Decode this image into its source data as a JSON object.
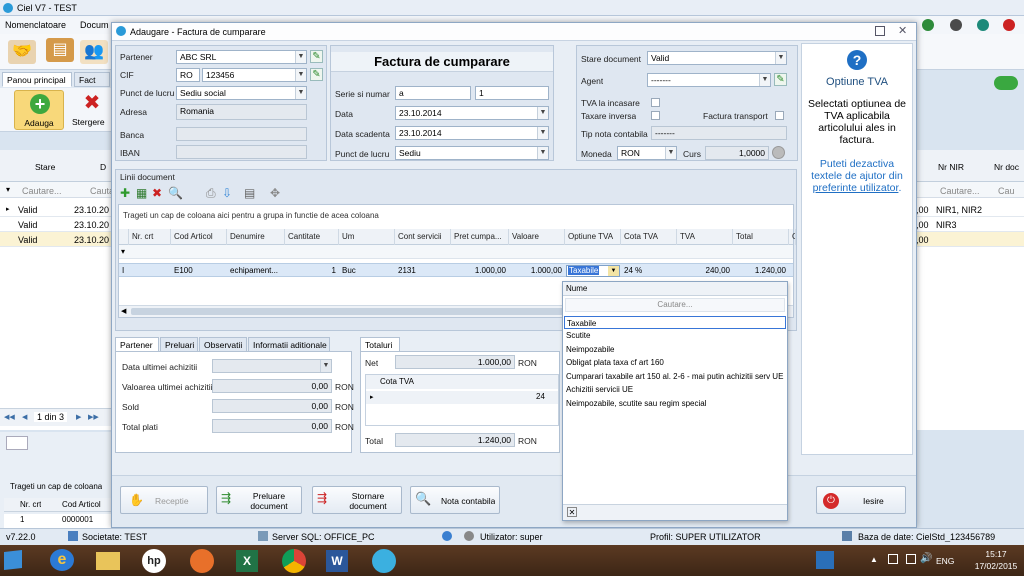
{
  "app": {
    "title": "Ciel V7 - TEST",
    "menu": [
      "Nomenclatoare",
      "Docum"
    ],
    "tabs": [
      "Panou principal",
      "Fact"
    ],
    "ribbon": {
      "add": "Adauga",
      "delete": "Stergere"
    },
    "left_grid": {
      "headers": [
        "Stare",
        "D"
      ],
      "filter_placeholder": "Cautare...",
      "filter_placeholder2": "Cauta",
      "rows": [
        [
          "Valid",
          "23.10.20"
        ],
        [
          "Valid",
          "23.10.20"
        ],
        [
          "Valid",
          "23.10.20"
        ]
      ],
      "pager": "1 din 3"
    },
    "right_grid": {
      "headers": [
        "Nr NIR",
        "Nr doc"
      ],
      "filter": "Cautare...",
      "filter2": "Cau",
      "rows": [
        [
          ",00",
          "NIR1, NIR2"
        ],
        [
          ",00",
          "NIR3"
        ],
        [
          ",00",
          ""
        ]
      ]
    },
    "bottom_panel": {
      "group_hint": "Trageti un cap de coloana",
      "headers": [
        "Nr. crt",
        "Cod Articol"
      ],
      "row": [
        "1",
        "0000001"
      ]
    },
    "status": {
      "version": "v7.22.0",
      "company": "Societate: TEST",
      "server": "Server SQL: OFFICE_PC",
      "user": "Utilizator: super",
      "profile": "Profil: SUPER UTILIZATOR",
      "database": "Baza de date: CielStd_123456789"
    },
    "taskbar": {
      "lang": "ENG",
      "time": "15:17",
      "date": "17/02/2015"
    }
  },
  "dialog": {
    "title": "Adaugare - Factura de cumparare",
    "partner": {
      "partner_label": "Partener",
      "partner_value": "ABC SRL",
      "cif_label": "CIF",
      "cif_prefix": "RO",
      "cif_value": "123456",
      "punct_label": "Punct de lucru",
      "punct_value": "Sediu social",
      "adresa_label": "Adresa",
      "adresa_value": "Romania",
      "banca_label": "Banca",
      "iban_label": "IBAN"
    },
    "header": {
      "heading": "Factura de cumparare",
      "serie_label": "Serie si numar",
      "serie_value": "a",
      "numar_value": "1",
      "data_label": "Data",
      "data_value": "23.10.2014",
      "scadenta_label": "Data scadenta",
      "scadenta_value": "23.10.2014",
      "punct_label": "Punct de lucru",
      "punct_value": "Sediu"
    },
    "status_box": {
      "stare_label": "Stare document",
      "stare_value": "Valid",
      "agent_label": "Agent",
      "agent_value": "-------",
      "tva_incasare": "TVA la incasare",
      "taxare_inversa": "Taxare inversa",
      "factura_transport": "Factura transport",
      "tip_nota_label": "Tip nota contabila",
      "tip_nota_value": "-------",
      "moneda_label": "Moneda",
      "moneda_value": "RON",
      "curs_label": "Curs",
      "curs_value": "1,0000"
    },
    "help": {
      "title": "Optiune TVA",
      "text": "Selectati optiunea de TVA aplicabila articolului ales in factura.",
      "text2": "Puteti dezactiva textele de ajutor din",
      "link": "preferinte utilizator",
      "period": "."
    },
    "lines": {
      "caption": "Linii document",
      "group_hint": "Trageti un cap de coloana aici pentru a grupa in functie de acea coloana",
      "columns": [
        "Nr. crt",
        "Cod Articol",
        "Denumire",
        "Cantitate",
        "Um",
        "Cont servicii",
        "Pret cumpa...",
        "Valoare",
        "Optiune TVA",
        "Cota TVA",
        "TVA",
        "Total",
        "C"
      ],
      "row": [
        "",
        "E100",
        "echipament...",
        "1",
        "Buc",
        "2131",
        "1.000,00",
        "1.000,00",
        "Taxabile",
        "24 %",
        "240,00",
        "1.240,00"
      ],
      "row_marker": "I"
    },
    "tva_popup": {
      "header": "Nume",
      "search_placeholder": "Cautare...",
      "options": [
        "Taxabile",
        "Scutite",
        "Neimpozabile",
        "Obligat plata taxa cf art 160",
        "Cumparari taxabile art 150 al. 2-6 - mai putin achizitii serv UE",
        "Achizitii servicii UE",
        "Neimpozabile, scutite sau regim special"
      ],
      "selected_index": 0
    },
    "partner_tabs": [
      "Partener",
      "Preluari",
      "Observatii",
      "Informatii aditionale"
    ],
    "partner_info": {
      "data_label": "Data ultimei achizitii",
      "valoare_label": "Valoarea ultimei achizitii",
      "valoare_value": "0,00",
      "valoare_cur": "RON",
      "sold_label": "Sold",
      "sold_value": "0,00",
      "sold_cur": "RON",
      "plati_label": "Total plati",
      "plati_value": "0,00",
      "plati_cur": "RON"
    },
    "totals": {
      "tab": "Totaluri",
      "net_label": "Net",
      "net_value": "1.000,00",
      "net_cur": "RON",
      "cota_header": "Cota TVA",
      "cota_partial": "24",
      "total_label": "Total",
      "total_value": "1.240,00",
      "total_cur": "RON"
    },
    "buttons": {
      "receptie": "Receptie",
      "preluare": "Preluare document",
      "stornare": "Stornare document",
      "nota": "Nota contabila",
      "iesire": "Iesire"
    }
  }
}
